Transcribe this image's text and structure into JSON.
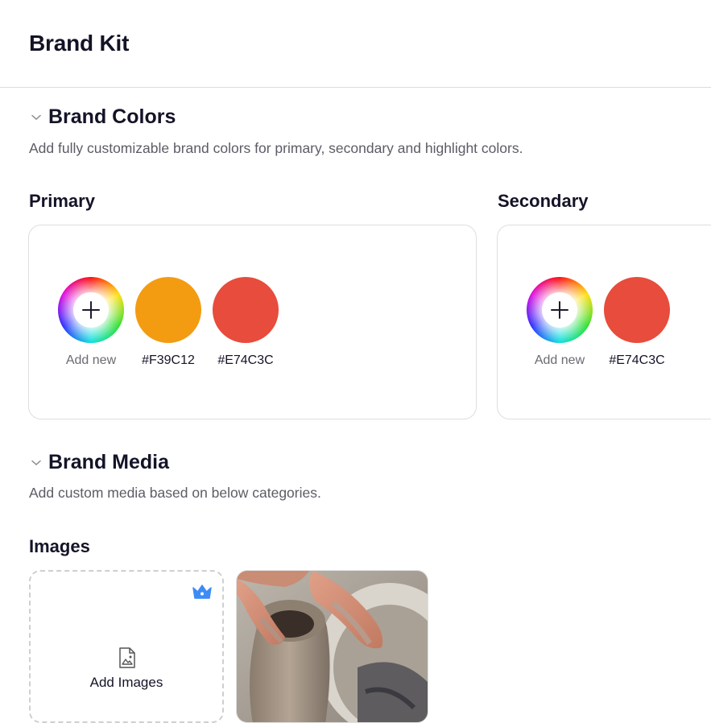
{
  "header": {
    "title": "Brand Kit"
  },
  "brand_colors": {
    "title": "Brand Colors",
    "description": "Add fully customizable brand colors for primary, secondary and highlight colors.",
    "primary": {
      "label": "Primary",
      "add_label": "Add new",
      "swatches": [
        {
          "hex": "#F39C12",
          "label": "#F39C12"
        },
        {
          "hex": "#E74C3C",
          "label": "#E74C3C"
        }
      ]
    },
    "secondary": {
      "label": "Secondary",
      "add_label": "Add new",
      "swatches": [
        {
          "hex": "#E74C3C",
          "label": "#E74C3C"
        }
      ]
    }
  },
  "brand_media": {
    "title": "Brand Media",
    "description": "Add custom media based on below categories.",
    "images": {
      "label": "Images",
      "add_label": "Add Images",
      "items": [
        {
          "icon": "pottery-photo"
        }
      ]
    }
  },
  "icons": {
    "chevron": "chevron-down-icon",
    "add": "plus-icon",
    "premium": "crown-icon",
    "image": "image-file-icon"
  },
  "colors": {
    "premium_blue": "#3d8bf5"
  }
}
